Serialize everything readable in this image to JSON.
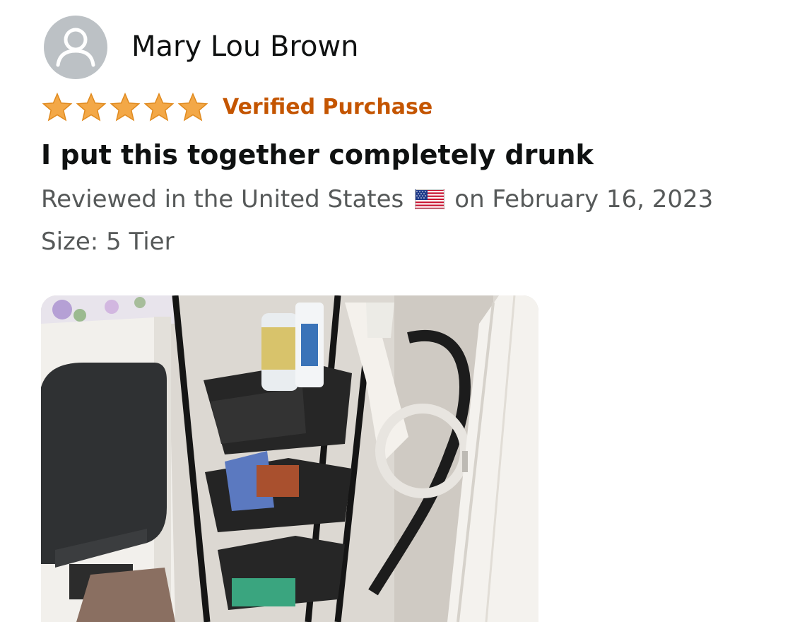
{
  "reviewer": {
    "name": "Mary Lou Brown",
    "avatar_icon": "user-silhouette-icon"
  },
  "rating": {
    "value": 5,
    "max": 5,
    "star_color": "#f3a847"
  },
  "verified_label": "Verified Purchase",
  "review_title": "I put this together completely drunk",
  "meta": {
    "reviewed_prefix": "Reviewed in the United States",
    "flag_icon": "us-flag-icon",
    "date_text": "on February 16, 2023"
  },
  "size_text": "Size: 5 Tier",
  "colors": {
    "name": "#0f1111",
    "verified": "#c45500",
    "secondary": "#565959"
  }
}
